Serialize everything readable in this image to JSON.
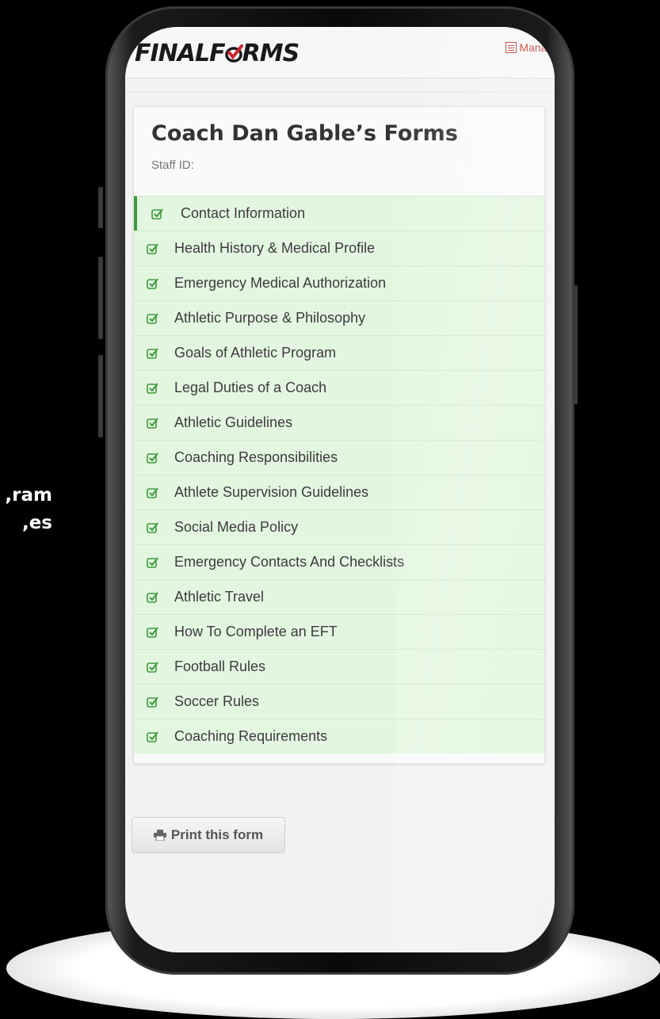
{
  "side_text": {
    "line1": "ram,",
    "line2": "es,"
  },
  "app": {
    "logo_part1": "Final",
    "logo_part2": "F",
    "logo_part3": "rms",
    "manage_label": "Manage"
  },
  "page": {
    "title": "Coach Dan Gable’s Forms",
    "staff_id_label": "Staff ID:"
  },
  "forms": [
    {
      "label": "Contact Information",
      "active": true
    },
    {
      "label": "Health History & Medical Profile"
    },
    {
      "label": "Emergency Medical Authorization"
    },
    {
      "label": "Athletic Purpose & Philosophy"
    },
    {
      "label": "Goals of Athletic Program"
    },
    {
      "label": "Legal Duties of a Coach"
    },
    {
      "label": "Athletic Guidelines"
    },
    {
      "label": "Coaching Responsibilities"
    },
    {
      "label": "Athlete Supervision Guidelines"
    },
    {
      "label": "Social Media Policy"
    },
    {
      "label": "Emergency Contacts And Checklists"
    },
    {
      "label": "Athletic Travel"
    },
    {
      "label": "How To Complete an EFT"
    },
    {
      "label": "Football Rules"
    },
    {
      "label": "Soccer Rules"
    },
    {
      "label": "Coaching Requirements"
    }
  ],
  "actions": {
    "print_label": "Print this form"
  },
  "icons": {
    "row_status": "checkbox-checked-icon",
    "print": "printer-icon",
    "manage": "manage-icon"
  },
  "colors": {
    "row_bg": "#e3f7e0",
    "check": "#3c9a3c",
    "brand_red": "#c0392b"
  }
}
